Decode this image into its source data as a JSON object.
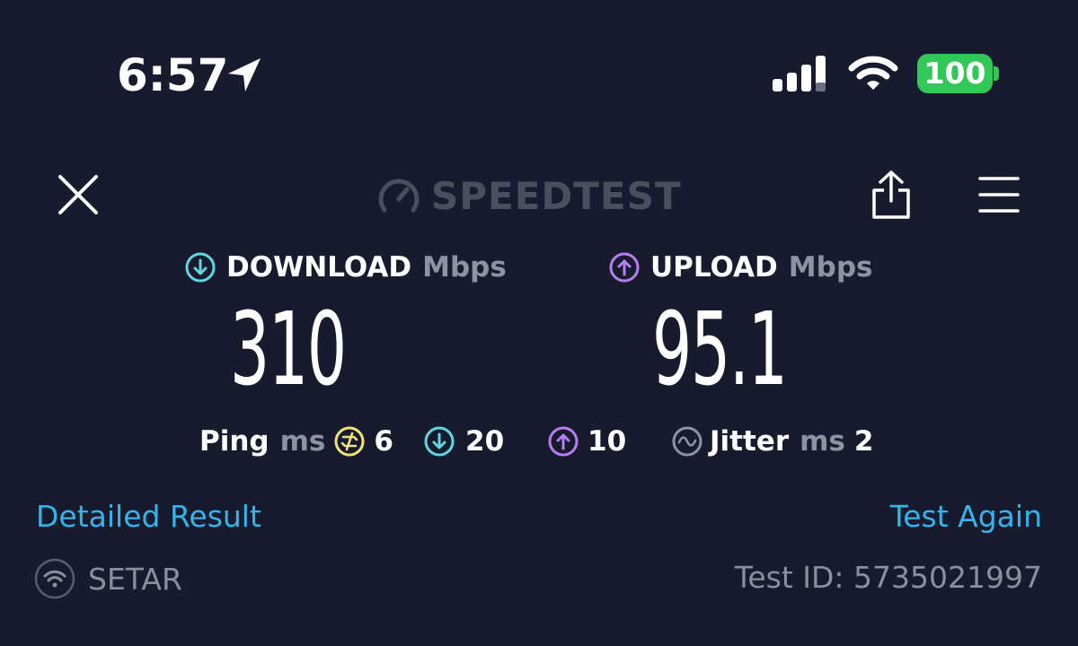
{
  "status_bar": {
    "time": "6:57",
    "battery": "100",
    "icons": [
      "location-arrow-icon",
      "cellular-signal-icon",
      "wifi-icon",
      "battery-icon"
    ]
  },
  "header": {
    "logo_text": "SPEEDTEST",
    "icons": [
      "close-icon",
      "speedometer-icon",
      "share-icon",
      "menu-icon"
    ]
  },
  "download": {
    "label": "DOWNLOAD",
    "unit": "Mbps",
    "value": "310",
    "color": "#5fd6e0"
  },
  "upload": {
    "label": "UPLOAD",
    "unit": "Mbps",
    "value": "95.1",
    "color": "#b67ff0"
  },
  "ping": {
    "label": "Ping",
    "unit": "ms",
    "idle": "6",
    "download": "20",
    "upload": "10",
    "idle_color": "#f3e27a"
  },
  "jitter": {
    "label": "Jitter",
    "unit": "ms",
    "value": "2"
  },
  "links": {
    "detailed": "Detailed Result",
    "again": "Test Again",
    "color": "#34b5ea"
  },
  "footer": {
    "isp": "SETAR",
    "test_id": "Test ID: 5735021997"
  }
}
